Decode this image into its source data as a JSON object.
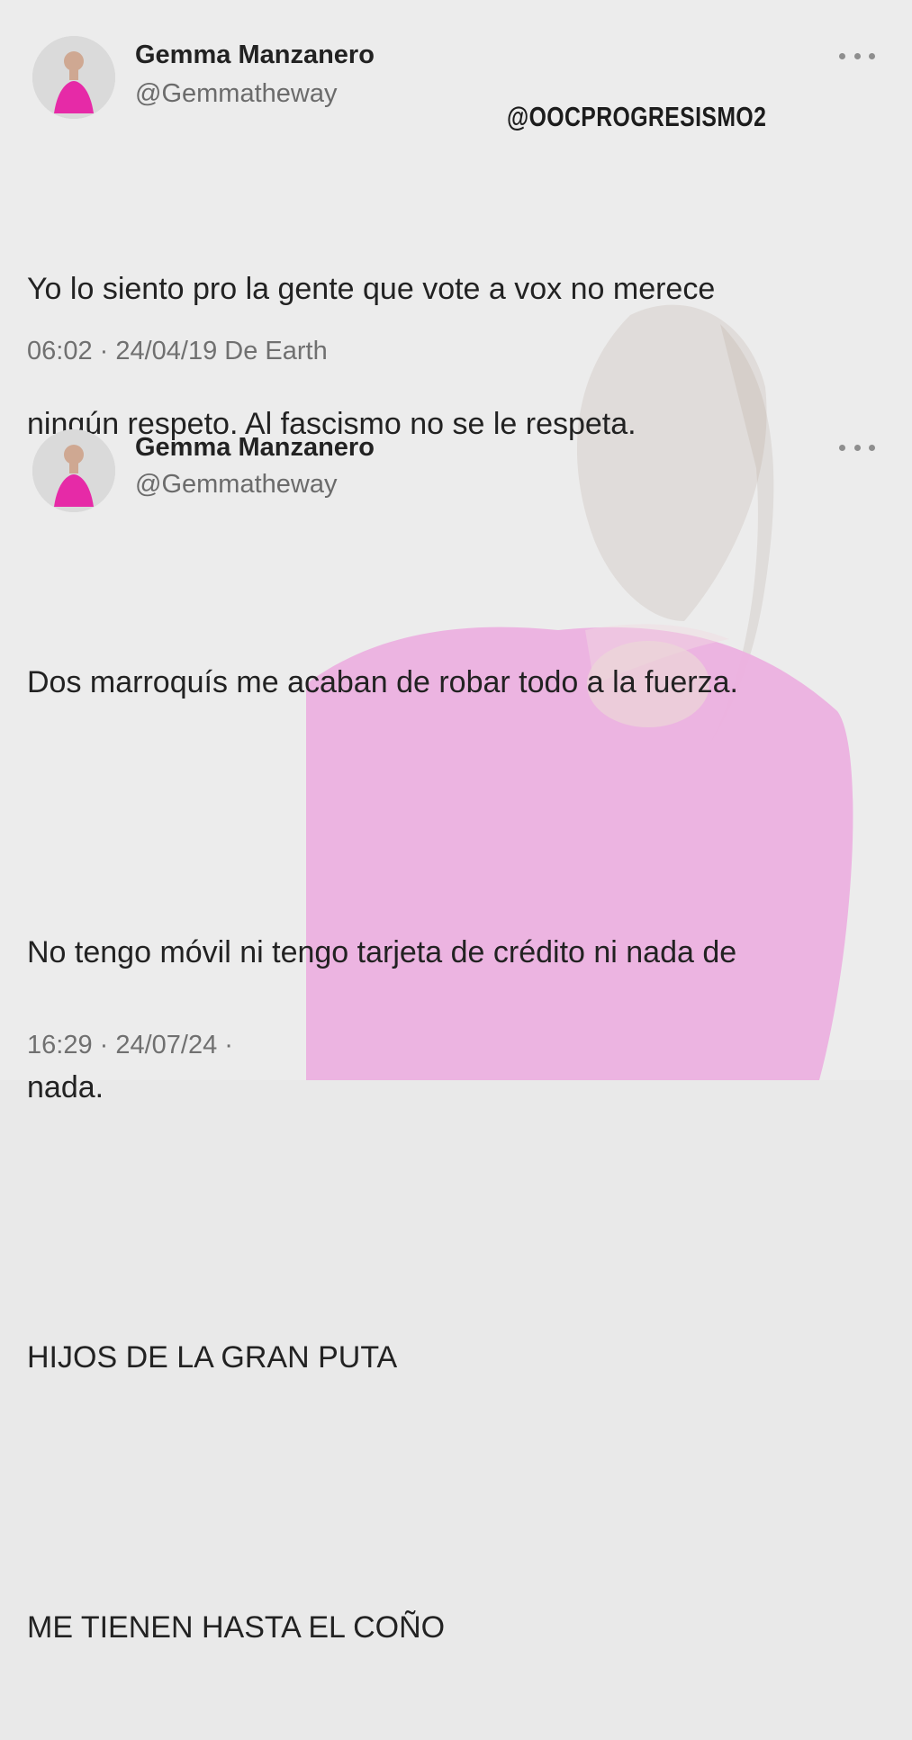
{
  "watermark": "@OOCPROGRESISMO2",
  "tweets": [
    {
      "author_name": "Gemma Manzanero",
      "handle": "@Gemmatheway",
      "text_lines": [
        "Yo lo siento pro la gente que vote a vox no merece",
        "ningún respeto. Al fascismo no se le respeta."
      ],
      "timestamp": "06:02 · 24/04/19 De Earth",
      "more_icon": "more-horizontal-icon"
    },
    {
      "author_name": "Gemma Manzanero",
      "handle": "@Gemmatheway",
      "paragraphs": [
        "Dos marroquís me acaban de robar todo a la fuerza.",
        "No tengo móvil ni tengo tarjeta de crédito ni nada de",
        "nada.",
        "HIJOS DE LA GRAN PUTA",
        "ME TIENEN HASTA EL COÑO"
      ],
      "timestamp": "16:29 · 24/07/24 ·",
      "more_icon": "more-horizontal-icon"
    }
  ],
  "colors": {
    "background": "#e9e9e9",
    "top_pink": "#e86fd0",
    "text": "#222222",
    "secondary_text": "#707070"
  }
}
